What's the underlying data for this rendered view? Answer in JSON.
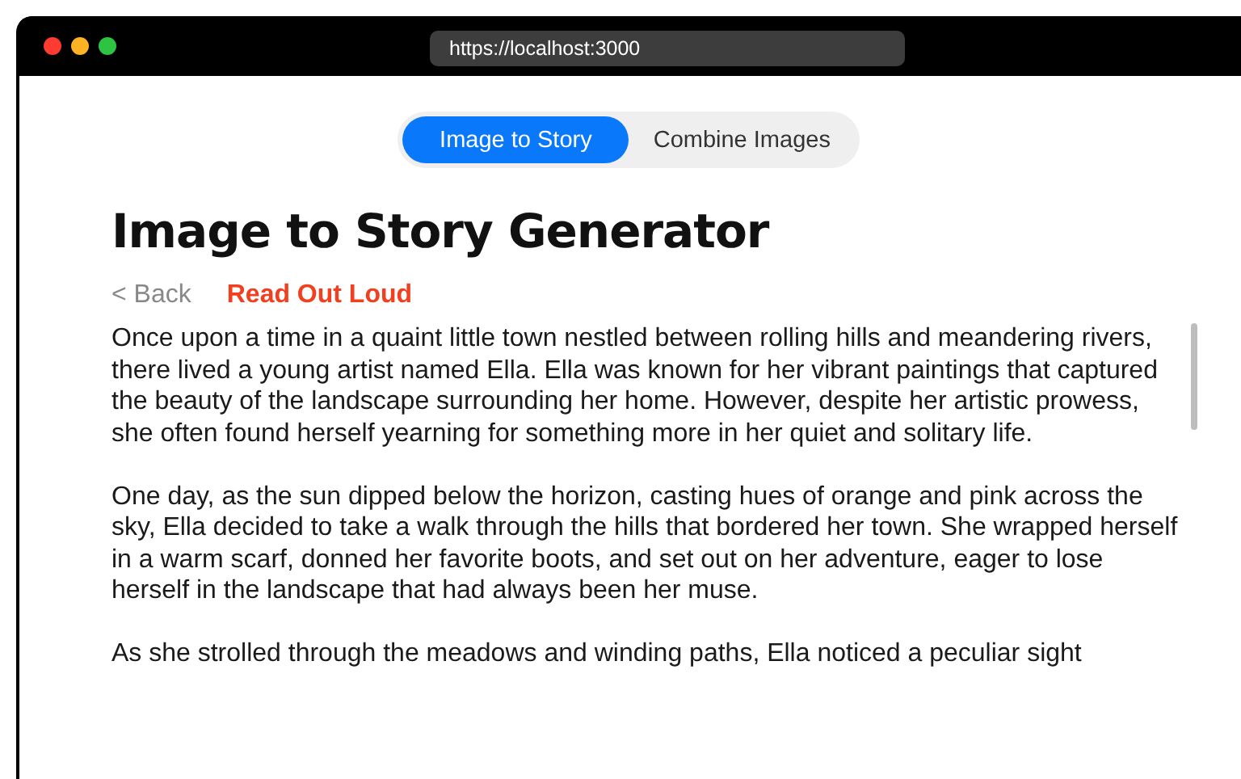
{
  "browser": {
    "url": "https://localhost:3000"
  },
  "tabs": [
    {
      "label": "Image to Story",
      "selected": true
    },
    {
      "label": "Combine Images",
      "selected": false
    }
  ],
  "heading": "Image to Story Generator",
  "back_link": "< Back",
  "read_aloud": "Read Out Loud",
  "story": [
    "Once upon a time in a quaint little town nestled between rolling hills and meandering rivers, there lived a young artist named Ella. Ella was known for her vibrant paintings that captured the beauty of the landscape surrounding her home. However, despite her artistic prowess, she often found herself yearning for something more in her quiet and solitary life.",
    "One day, as the sun dipped below the horizon, casting hues of orange and pink across the sky, Ella decided to take a walk through the hills that bordered her town. She wrapped herself in a warm scarf, donned her favorite boots, and set out on her adventure, eager to lose herself in the landscape that had always been her muse.",
    "As she strolled through the meadows and winding paths, Ella noticed a peculiar sight"
  ]
}
